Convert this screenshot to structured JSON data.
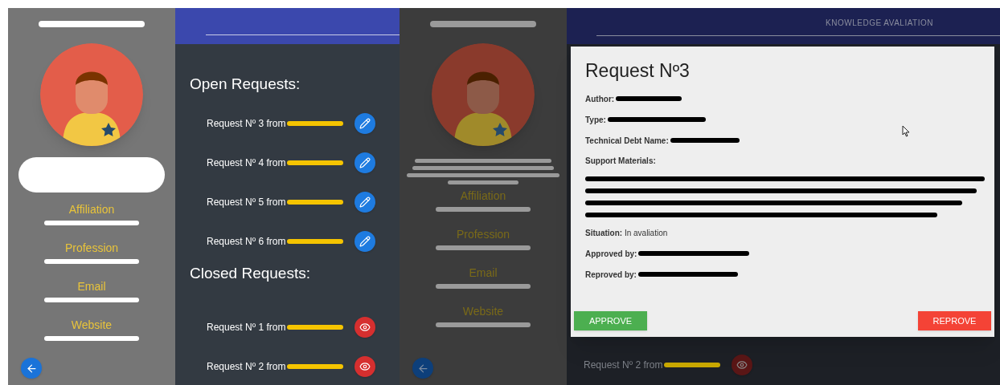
{
  "left_screen": {
    "sidebar": {
      "fields": [
        {
          "label": "Affiliation"
        },
        {
          "label": "Profession"
        },
        {
          "label": "Email"
        },
        {
          "label": "Website"
        }
      ]
    },
    "open_requests": {
      "title": "Open Requests:",
      "items": [
        {
          "label": "Request Nº 3 from"
        },
        {
          "label": "Request Nº 4 from"
        },
        {
          "label": "Request Nº 5 from"
        },
        {
          "label": "Request Nº 6 from"
        }
      ]
    },
    "closed_requests": {
      "title": "Closed Requests:",
      "items": [
        {
          "label": "Request Nº 1 from"
        },
        {
          "label": "Request Nº 2 from"
        }
      ]
    }
  },
  "right_screen": {
    "sidebar": {
      "fields": [
        {
          "label": "Affiliation"
        },
        {
          "label": "Profession"
        },
        {
          "label": "Email"
        },
        {
          "label": "Website"
        }
      ]
    },
    "header": {
      "title": "KNOWLEDGE AVALIATION"
    },
    "dialog": {
      "title": "Request Nº3",
      "fields": [
        {
          "label": "Author:"
        },
        {
          "label": "Type:"
        },
        {
          "label": "Technical Debt Name:"
        }
      ],
      "support_materials": {
        "label": "Support Materials:"
      },
      "situation": {
        "label": "Situation:",
        "value": "In avaliation"
      },
      "approvals": [
        {
          "label": "Approved by:"
        },
        {
          "label": "Reproved by:"
        }
      ],
      "buttons": [
        {
          "label": "APPROVE",
          "kind": "approve"
        },
        {
          "label": "REPROVE",
          "kind": "reprove"
        }
      ]
    },
    "background_requests": [
      {
        "label": "Request Nº 2 from"
      }
    ]
  }
}
